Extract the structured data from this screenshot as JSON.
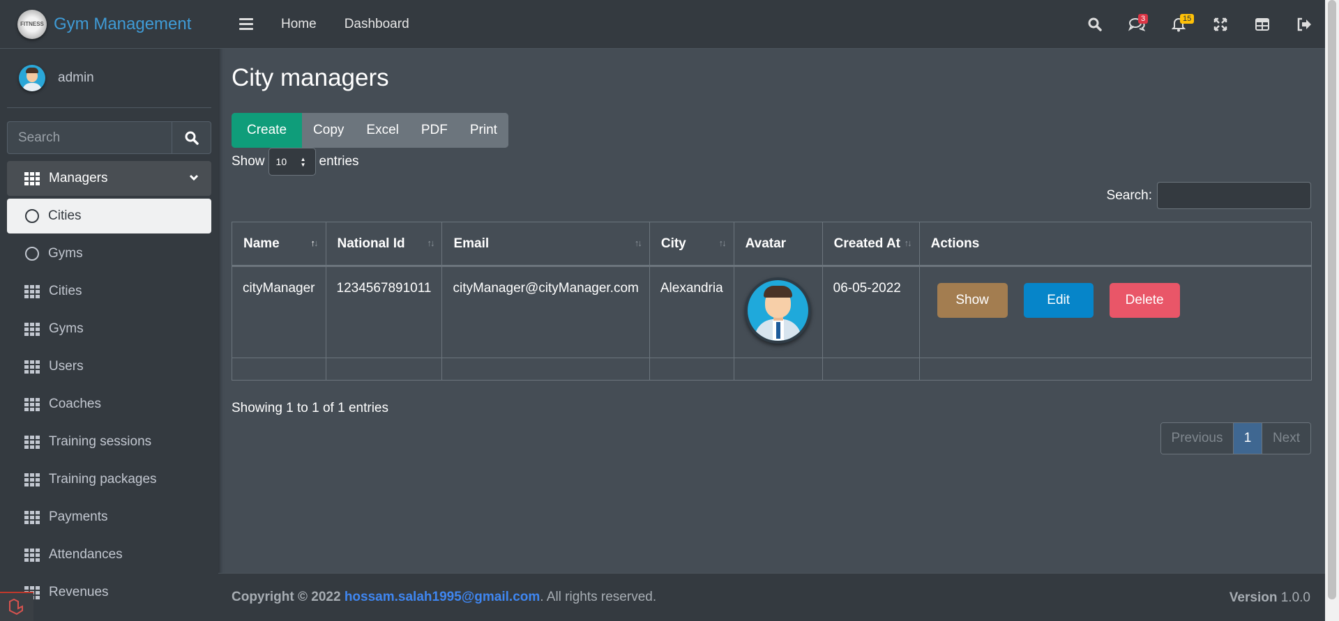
{
  "brand": {
    "title": "Gym Management",
    "logo_text": "FITNESS"
  },
  "user": {
    "name": "admin"
  },
  "sidebar": {
    "search_placeholder": "Search",
    "items": [
      {
        "label": "Managers",
        "icon": "grid-icon",
        "state": "open"
      },
      {
        "label": "Cities",
        "icon": "circle-icon",
        "state": "active"
      },
      {
        "label": "Gyms",
        "icon": "circle-icon",
        "state": ""
      },
      {
        "label": "Cities",
        "icon": "grid-icon",
        "state": ""
      },
      {
        "label": "Gyms",
        "icon": "grid-icon",
        "state": ""
      },
      {
        "label": "Users",
        "icon": "grid-icon",
        "state": ""
      },
      {
        "label": "Coaches",
        "icon": "grid-icon",
        "state": ""
      },
      {
        "label": "Training sessions",
        "icon": "grid-icon",
        "state": ""
      },
      {
        "label": "Training packages",
        "icon": "grid-icon",
        "state": ""
      },
      {
        "label": "Payments",
        "icon": "grid-icon",
        "state": ""
      },
      {
        "label": "Attendances",
        "icon": "grid-icon",
        "state": ""
      },
      {
        "label": "Revenues",
        "icon": "grid-icon",
        "state": ""
      }
    ]
  },
  "header": {
    "links": [
      "Home",
      "Dashboard"
    ],
    "messages_count": "3",
    "notifications_count": "15",
    "icons": [
      "search-icon",
      "comments-icon",
      "bell-icon",
      "fullscreen-icon",
      "layout-icon",
      "logout-icon"
    ]
  },
  "page": {
    "title": "City managers",
    "buttons": [
      "Create",
      "Copy",
      "Excel",
      "PDF",
      "Print"
    ],
    "length": {
      "before": "Show",
      "value": "10",
      "after": "entries"
    },
    "search_label": "Search:",
    "table": {
      "headers": [
        "Name",
        "National Id",
        "Email",
        "City",
        "Avatar",
        "Created At",
        "Actions"
      ],
      "rows": [
        {
          "name": "cityManager",
          "national_id": "1234567891011",
          "email": "cityManager@cityManager.com",
          "city": "Alexandria",
          "created_at": "06-05-2022",
          "actions": [
            "Show",
            "Edit",
            "Delete"
          ]
        }
      ]
    },
    "info": "Showing 1 to 1 of 1 entries",
    "pagination": {
      "previous": "Previous",
      "current": "1",
      "next": "Next"
    }
  },
  "footer": {
    "copyright": "Copyright © 2022",
    "email": "hossam.salah1995@gmail.com",
    "rights": ". All rights reserved.",
    "version_label": "Version",
    "version": "1.0.0"
  },
  "colors": {
    "create": "#0f9d7a",
    "show": "#a37d50",
    "edit": "#0685c9",
    "delete": "#e95668",
    "brand": "#3f9bd6",
    "link": "#3f86f0"
  }
}
